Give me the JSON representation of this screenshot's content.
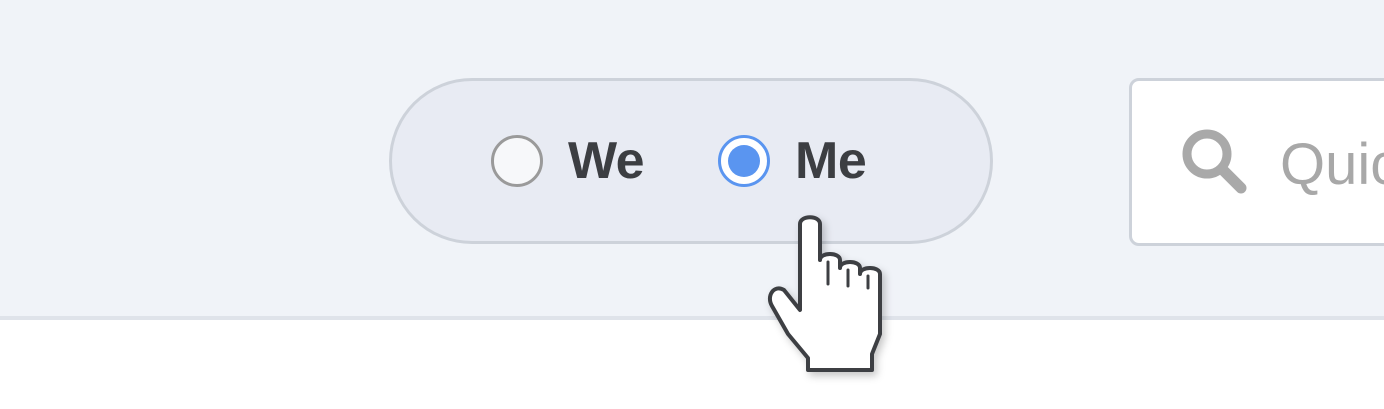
{
  "scope_toggle": {
    "options": [
      {
        "label": "We",
        "checked": false
      },
      {
        "label": "Me",
        "checked": true
      }
    ],
    "selected": "Me"
  },
  "search": {
    "placeholder": "Quick search",
    "value": ""
  },
  "icons": {
    "search": "search-icon",
    "cursor": "hand-pointer-cursor"
  },
  "colors": {
    "radio_accent": "#5a95f0",
    "header_background": "#f0f3f8",
    "toggle_background": "#e8ebf3"
  }
}
